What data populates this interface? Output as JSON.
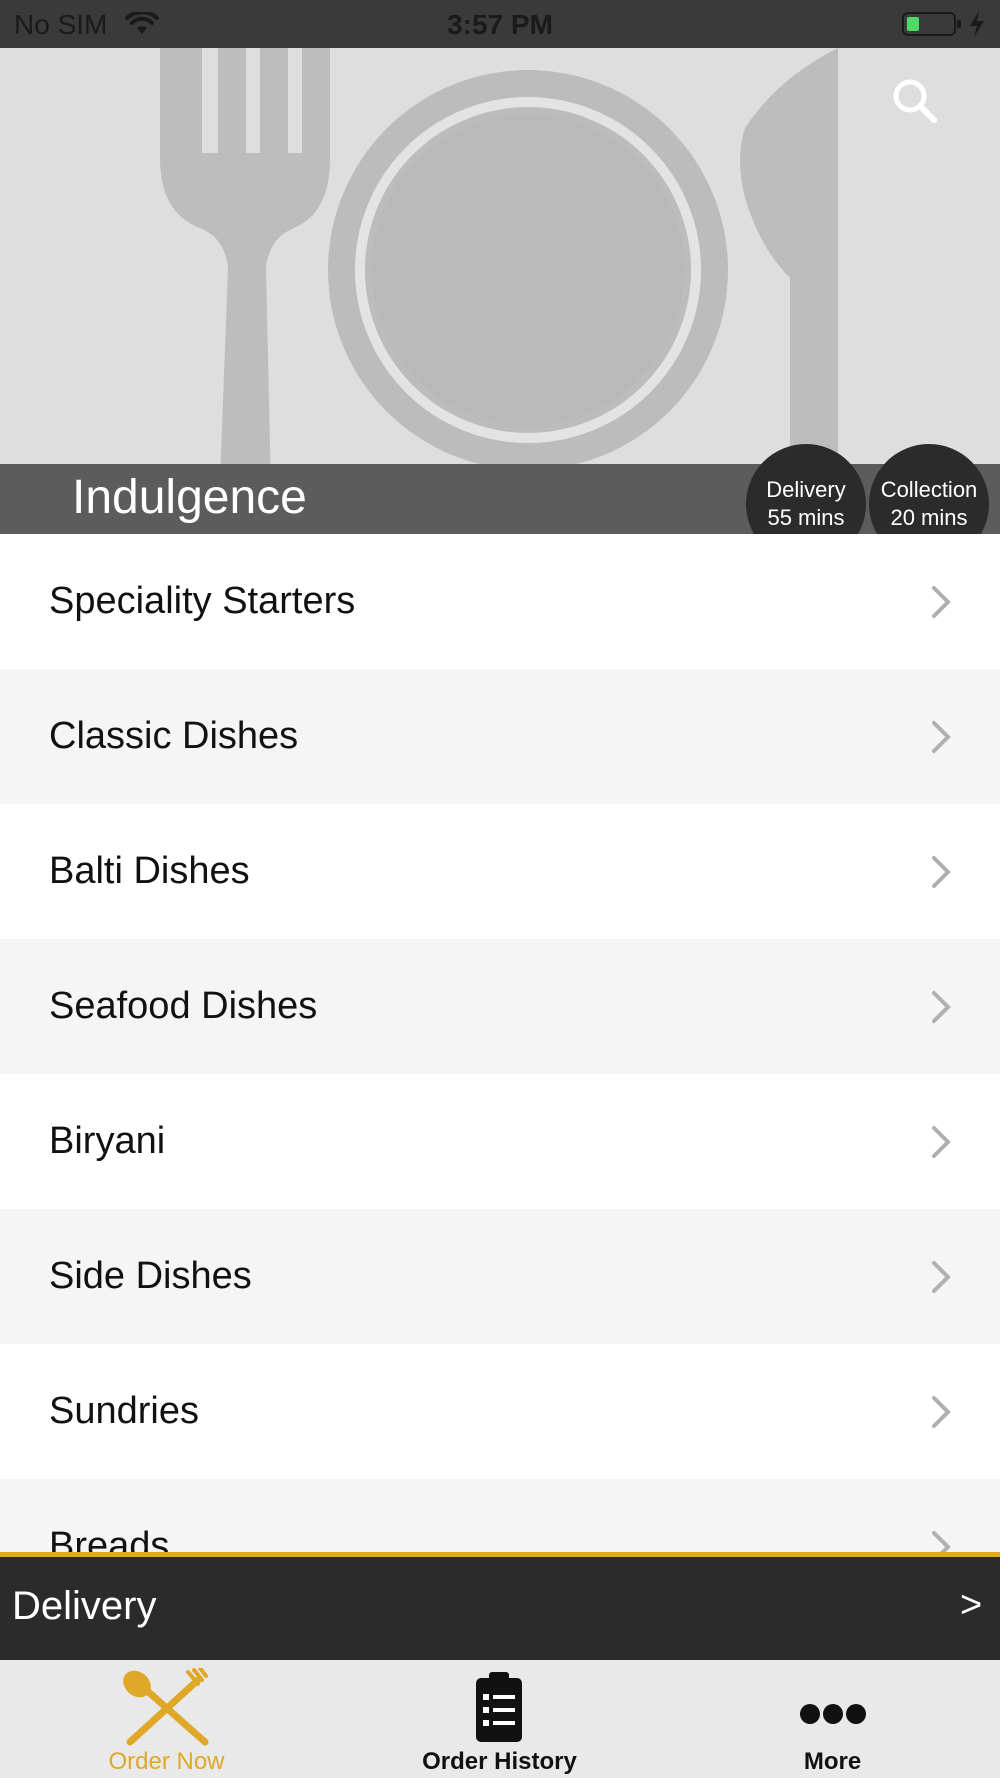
{
  "status_bar": {
    "carrier": "No SIM",
    "time": "3:57 PM",
    "battery_color": "#4cd964"
  },
  "hero": {
    "restaurant_name": "Indulgence",
    "delivery_badge": {
      "label": "Delivery",
      "time": "55 mins"
    },
    "collection_badge": {
      "label": "Collection",
      "time": "20 mins"
    },
    "search_icon": "search-icon"
  },
  "categories": [
    {
      "label": "Speciality Starters"
    },
    {
      "label": "Classic Dishes"
    },
    {
      "label": "Balti Dishes"
    },
    {
      "label": "Seafood Dishes"
    },
    {
      "label": "Biryani"
    },
    {
      "label": "Side Dishes"
    },
    {
      "label": "Sundries"
    },
    {
      "label": "Breads"
    }
  ],
  "order_mode_bar": {
    "mode": "Delivery",
    "arrow": ">"
  },
  "tabs": [
    {
      "label": "Order Now",
      "icon": "fork-spoon-icon",
      "active": true
    },
    {
      "label": "Order History",
      "icon": "clipboard-list-icon",
      "active": false
    },
    {
      "label": "More",
      "icon": "more-dots-icon",
      "active": false
    }
  ],
  "colors": {
    "accent": "#e0a829",
    "dark_bar": "#2b2b2b",
    "tab_inactive": "#111111"
  }
}
